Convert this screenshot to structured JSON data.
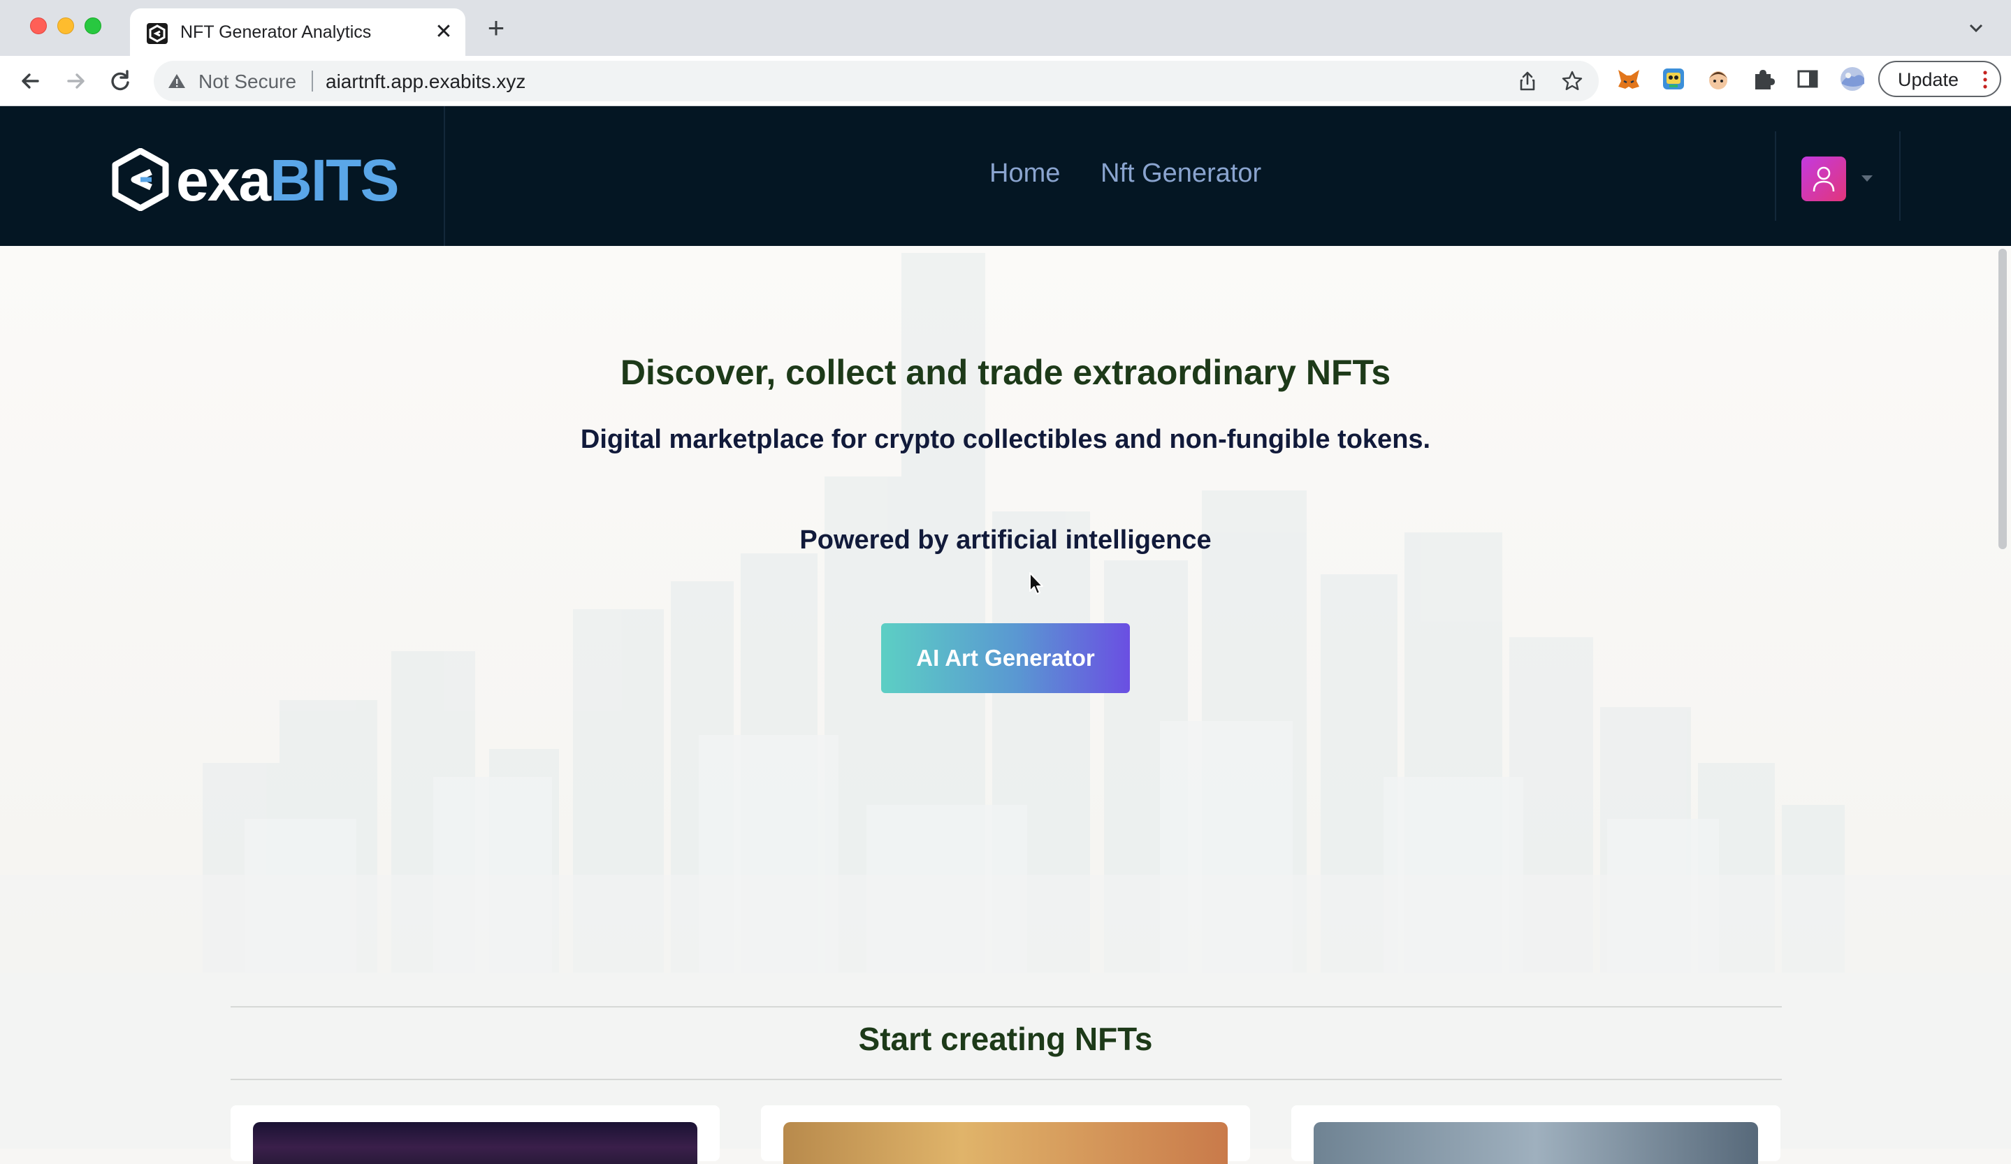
{
  "browser": {
    "tab_title": "NFT Generator Analytics",
    "security_label": "Not Secure",
    "url": "aiartnft.app.exabits.xyz",
    "update_label": "Update"
  },
  "site": {
    "logo_prefix": "exa",
    "logo_suffix": "BITS",
    "nav": [
      {
        "label": "Home"
      },
      {
        "label": "Nft Generator"
      }
    ]
  },
  "hero": {
    "title": "Discover, collect and trade extraordinary NFTs",
    "subtitle": "Digital marketplace for crypto collectibles and non-fungible tokens.",
    "powered": "Powered by artificial intelligence",
    "cta_label": "AI Art Generator"
  },
  "create_section": {
    "title": "Start creating NFTs"
  },
  "colors": {
    "header_bg": "#041623",
    "nav_link": "#8aa4cf",
    "hero_title": "#1d3a19",
    "cta_start": "#5ccfc4",
    "cta_end": "#6a4fe2"
  }
}
